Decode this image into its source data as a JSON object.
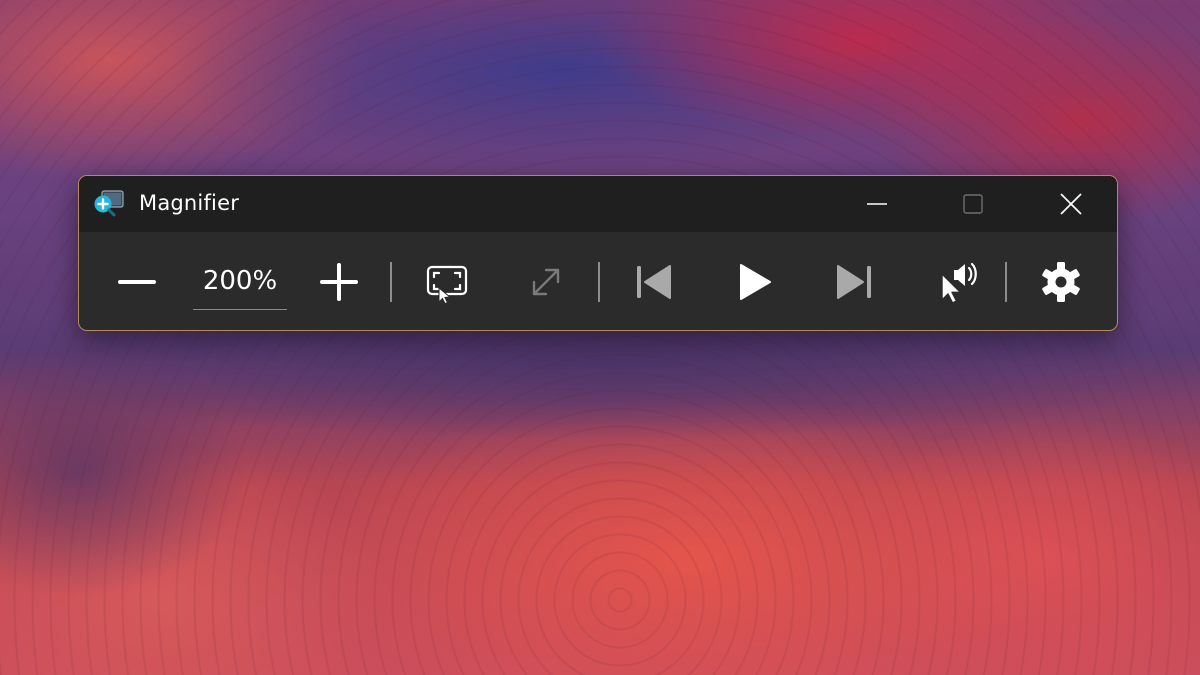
{
  "window": {
    "title": "Magnifier",
    "icon": "magnifier-app-icon"
  },
  "caption_buttons": {
    "minimize_icon": "minimize-icon",
    "maximize_icon": "maximize-icon",
    "close_icon": "close-icon"
  },
  "toolbar": {
    "zoom_level": "200%",
    "zoom_out_icon": "minus-icon",
    "zoom_in_icon": "plus-icon",
    "view_icon": "full-screen-view-icon",
    "expand_icon": "expand-arrows-icon",
    "expand_enabled": false,
    "previous_icon": "skip-previous-icon",
    "play_icon": "play-icon",
    "next_icon": "skip-next-icon",
    "read_from_here_icon": "cursor-speaker-icon",
    "settings_icon": "gear-icon"
  },
  "colors": {
    "titlebar": "#1f1f1f",
    "toolbar": "#2b2b2b",
    "border": "#b48a5a",
    "icon": "#ffffff",
    "icon_disabled": "#7a7a7a",
    "app_icon_accent": "#29b6d8"
  }
}
